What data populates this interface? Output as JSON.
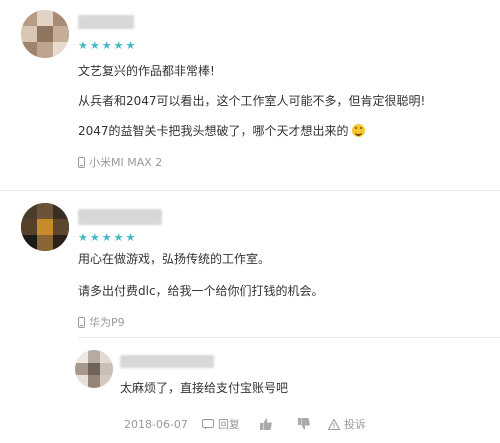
{
  "comments": [
    {
      "rating_stars": 5,
      "paragraphs": [
        "文艺复兴的作品都非常棒!",
        "从兵者和2047可以看出，这个工作室人可能不多，但肯定很聪明!",
        "2047的益智关卡把我头想破了，哪个天才想出来的"
      ],
      "device": "小米MI MAX 2"
    },
    {
      "rating_stars": 5,
      "paragraphs": [
        "用心在做游戏，弘扬传统的工作室。",
        "请多出付费dlc，给我一个给你们打钱的机会。"
      ],
      "device": "华为P9"
    }
  ],
  "reply": {
    "text": "太麻烦了，直接给支付宝账号吧",
    "date": "2018-06-07",
    "reply_label": "回复",
    "report_label": "投诉"
  },
  "colors": {
    "star": "#43b9c8",
    "muted": "#999999",
    "divider": "#e9e9e9"
  }
}
